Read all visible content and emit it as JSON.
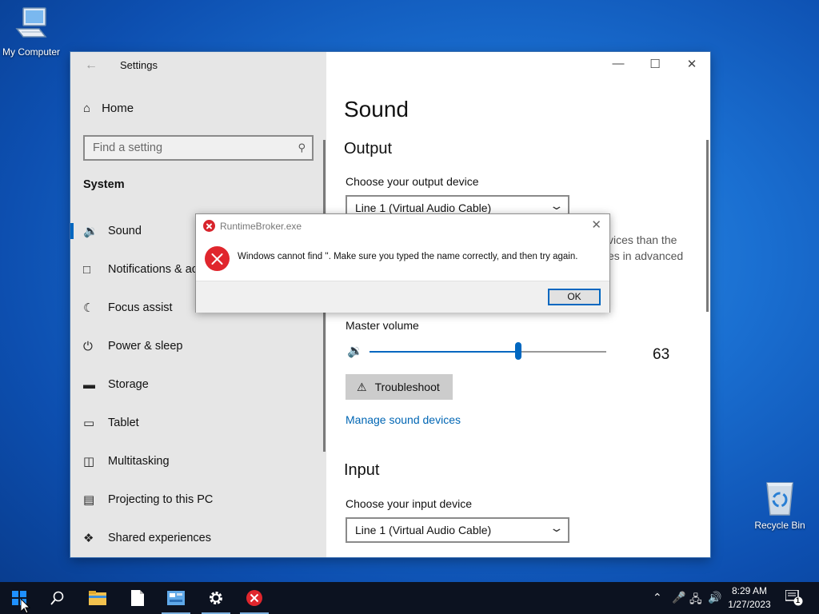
{
  "desktop": {
    "icons": [
      {
        "label": "My Computer",
        "icon": "computer-icon"
      },
      {
        "label": "Recycle Bin",
        "icon": "recycle-bin-icon"
      }
    ]
  },
  "settings": {
    "title": "Settings",
    "nav": {
      "home": "Home",
      "search_placeholder": "Find a setting",
      "section": "System",
      "items": [
        {
          "label": "Sound",
          "icon": "speaker-icon",
          "active": true
        },
        {
          "label": "Notifications & actions",
          "icon": "notifications-icon"
        },
        {
          "label": "Focus assist",
          "icon": "moon-icon"
        },
        {
          "label": "Power & sleep",
          "icon": "power-icon"
        },
        {
          "label": "Storage",
          "icon": "storage-icon"
        },
        {
          "label": "Tablet",
          "icon": "tablet-icon"
        },
        {
          "label": "Multitasking",
          "icon": "multitasking-icon"
        },
        {
          "label": "Projecting to this PC",
          "icon": "projecting-icon"
        },
        {
          "label": "Shared experiences",
          "icon": "shared-icon"
        }
      ]
    },
    "main": {
      "title": "Sound",
      "output": {
        "heading": "Output",
        "device_label": "Choose your output device",
        "device_value": "Line 1 (Virtual Audio Cable)",
        "partial_line1": "vices than the",
        "partial_line2": "es in advanced",
        "volume_label": "Master volume",
        "volume_value": "63",
        "volume_fraction": 0.63,
        "troubleshoot": "Troubleshoot",
        "manage_link": "Manage sound devices"
      },
      "input": {
        "heading": "Input",
        "device_label": "Choose your input device",
        "device_value": "Line 1 (Virtual Audio Cable)"
      }
    }
  },
  "dialog": {
    "title": "RuntimeBroker.exe",
    "message": "Windows cannot find ''. Make sure you typed the name correctly, and then try again.",
    "ok": "OK"
  },
  "taskbar": {
    "time": "8:29 AM",
    "date": "1/27/2023",
    "notification_count": "1",
    "accent": "#0067c0"
  }
}
